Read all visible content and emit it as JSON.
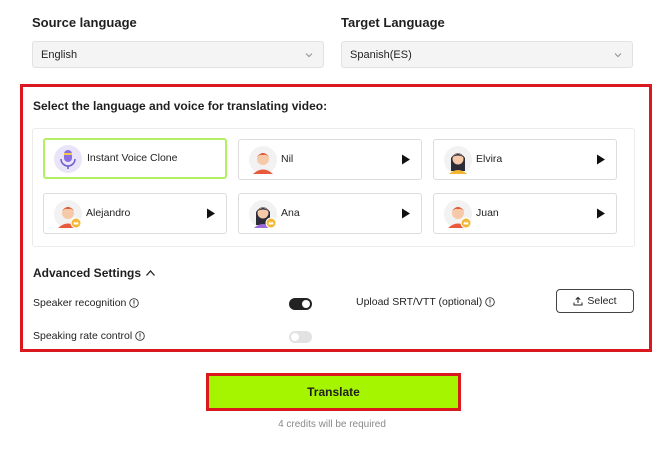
{
  "source": {
    "label": "Source language",
    "value": "English"
  },
  "target": {
    "label": "Target Language",
    "value": "Spanish(ES)"
  },
  "voice_panel": {
    "title": "Select the language and voice for translating video:",
    "voices": [
      {
        "name": "Instant Voice Clone",
        "selected": true,
        "avatar": "voice-clone-icon"
      },
      {
        "name": "Nil",
        "avatar": "male-avatar"
      },
      {
        "name": "Elvira",
        "avatar": "female-avatar"
      },
      {
        "name": "Alejandro",
        "avatar": "male-avatar",
        "premium": true
      },
      {
        "name": "Ana",
        "avatar": "female-avatar",
        "premium": true
      },
      {
        "name": "Juan",
        "avatar": "male-avatar",
        "premium": true
      }
    ]
  },
  "advanced": {
    "title": "Advanced Settings",
    "speaker_recognition": {
      "label": "Speaker recognition",
      "on": true
    },
    "speaking_rate": {
      "label": "Speaking rate control",
      "on": false
    },
    "upload": {
      "label": "Upload SRT/VTT (optional)",
      "button": "Select"
    }
  },
  "translate": {
    "label": "Translate",
    "credits_note": "4 credits will be required"
  },
  "colors": {
    "accent": "#a6f500",
    "highlight_border": "#d9181f",
    "selected_border": "#b3ef63"
  }
}
